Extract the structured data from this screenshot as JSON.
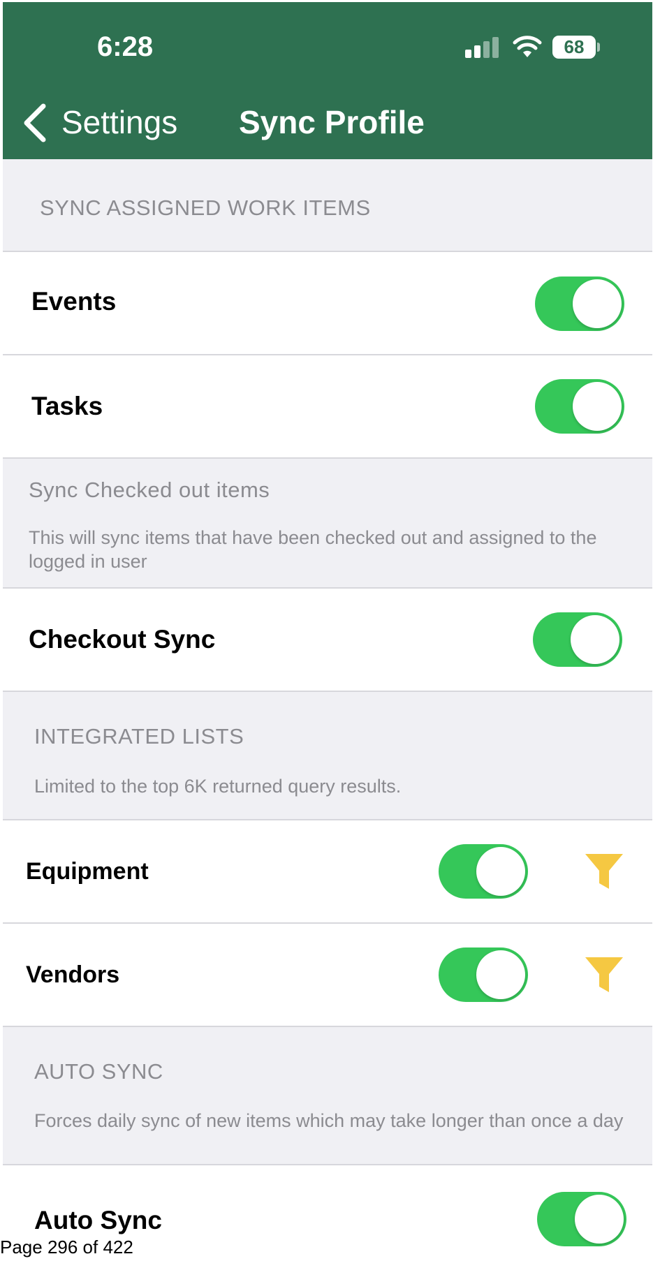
{
  "status_bar": {
    "time": "6:28",
    "battery": "68"
  },
  "nav": {
    "back_label": "Settings",
    "title": "Sync Profile"
  },
  "sections": {
    "assigned": {
      "label": "SYNC ASSIGNED WORK ITEMS"
    },
    "checked_out": {
      "label": "Sync Checked out items",
      "description": "This will sync items that have been checked out and assigned to the logged in user"
    },
    "integrated": {
      "label": "INTEGRATED LISTS",
      "description": "Limited to the top 6K returned query results."
    },
    "auto": {
      "label": "AUTO SYNC",
      "description": "Forces daily sync of new items which may take longer than once a day"
    }
  },
  "rows": {
    "events": {
      "label": "Events",
      "on": true
    },
    "tasks": {
      "label": "Tasks",
      "on": true
    },
    "checkout_sync": {
      "label": "Checkout Sync",
      "on": true
    },
    "equipment": {
      "label": "Equipment",
      "on": true,
      "filter_icon": "funnel-icon"
    },
    "vendors": {
      "label": "Vendors",
      "on": true,
      "filter_icon": "funnel-icon"
    },
    "auto_sync": {
      "label": "Auto Sync",
      "on": true
    }
  },
  "colors": {
    "nav_bar": "#2e7151",
    "toggle_on": "#35c759",
    "filter_icon": "#f5c842",
    "section_text": "#8b8b90"
  },
  "footer": {
    "page_text": "Page 296 of 422"
  }
}
